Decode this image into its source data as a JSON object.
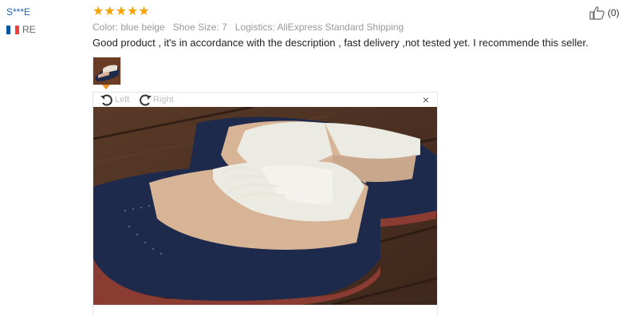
{
  "reviewer": {
    "name": "S***E",
    "country_code": "RE",
    "flag_colors": [
      "#0055a4",
      "#ffffff",
      "#ef4135"
    ]
  },
  "rating": {
    "stars": 5,
    "max": 5,
    "color": "#f4a300"
  },
  "meta": {
    "color": "Color: blue beige",
    "size": "Shoe Size: 7",
    "logistics": "Logistics: AliExpress Standard Shipping"
  },
  "review": {
    "text": "Good product , it's in accordance with the description , fast delivery ,not tested yet. I recommende this seller."
  },
  "viewer": {
    "rotate_left": "Left",
    "rotate_right": "Right",
    "close": "×",
    "image_subject": "blue-beige-brogue-shoes"
  },
  "helpful": {
    "icon": "thumbs-up-icon",
    "count": "(0)"
  },
  "colors": {
    "link": "#2265b5",
    "accent": "#f08c1a"
  }
}
